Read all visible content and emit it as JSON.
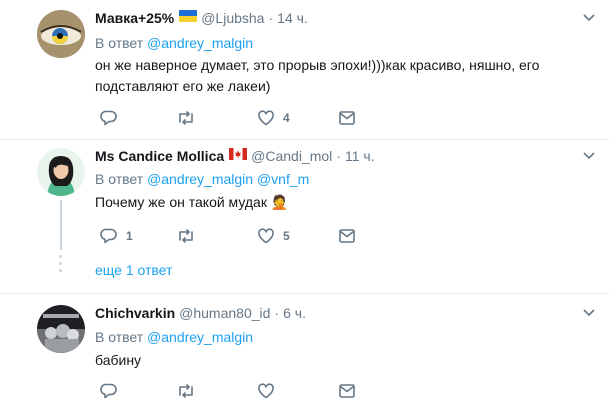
{
  "tweets": [
    {
      "name": "Мавка+25%",
      "handle": "@Ljubsha",
      "time": "14 ч.",
      "reply_prefix": "В ответ",
      "reply_users": [
        "@andrey_malgin"
      ],
      "text": "он же наверное думает, это прорыв эпохи!)))как красиво, няшно, его подставляют его же лакеи)",
      "reply_count": "",
      "like_count": "4",
      "flag_icon": "ukraine-flag-icon"
    },
    {
      "name": "Ms Candice Mollica",
      "handle": "@Candi_mol",
      "time": "11 ч.",
      "reply_prefix": "В ответ",
      "reply_users": [
        "@andrey_malgin",
        "@vnf_m"
      ],
      "text": "Почему же он такой мудак 🤦",
      "reply_count": "1",
      "like_count": "5",
      "flag_icon": "canada-flag-icon",
      "more_replies": "еще 1 ответ"
    },
    {
      "name": "Chichvarkin",
      "handle": "@human80_id",
      "time": "6 ч.",
      "reply_prefix": "В ответ",
      "reply_users": [
        "@andrey_malgin"
      ],
      "text": "бабину",
      "reply_count": "",
      "like_count": ""
    }
  ],
  "colors": {
    "link": "#1da1f2",
    "muted": "#657786",
    "divider": "#e6ecf0"
  }
}
